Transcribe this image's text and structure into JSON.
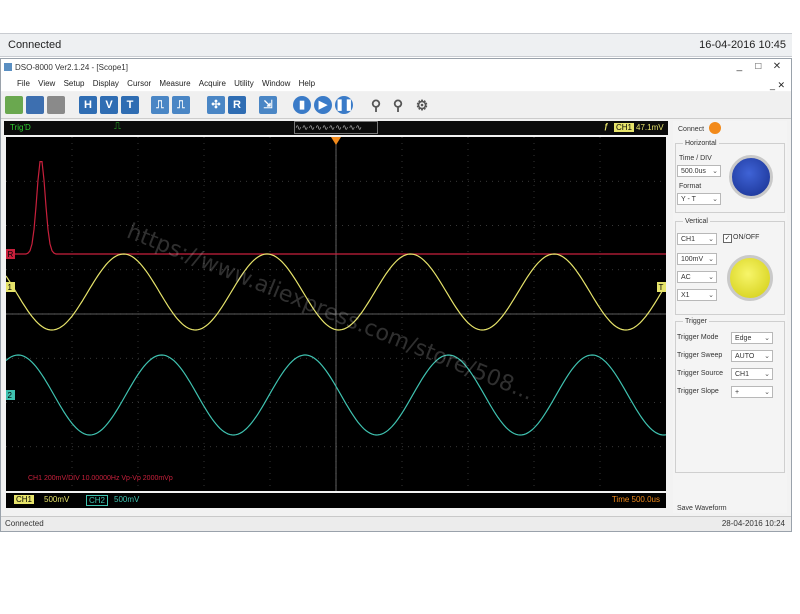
{
  "top_status": {
    "left": "Connected",
    "right": "16-04-2016  10:45"
  },
  "window": {
    "title": "DSO-8000 Ver2.1.24 - [Scope1]",
    "buttons": [
      "_",
      "□",
      "✕"
    ]
  },
  "menu": [
    "File",
    "View",
    "Setup",
    "Display",
    "Cursor",
    "Measure",
    "Acquire",
    "Utility",
    "Window",
    "Help"
  ],
  "menu_mdi_buttons": "_ ✕",
  "toolbar": {
    "letter_buttons": [
      "H",
      "V",
      "T",
      "R"
    ],
    "icons": [
      "open-folder-icon",
      "save-icon",
      "print-icon",
      "horizontal-icon",
      "vertical-icon",
      "trigger-icon",
      "pulse-icon",
      "pulse-icon",
      "measure-icon",
      "reference-icon",
      "export-icon",
      "single-icon",
      "run-icon",
      "stop-icon",
      "zoom-in-icon",
      "zoom-out-icon",
      "settings-icon"
    ]
  },
  "scope_bar": {
    "status": "Trig'D",
    "trigger_ch": "CH1",
    "trigger_level": "47.1mV"
  },
  "scope_info": {
    "line": "CH1  200mV/DIV   10.00000Hz   Vp-Vp  2000mVp"
  },
  "channel_markers": {
    "ref": "R",
    "ch1": "1",
    "ch2": "2",
    "trig": "T"
  },
  "bottom_bar": {
    "ch1_label": "CH1",
    "ch1_scale": "500mV",
    "ch2_label": "CH2",
    "ch2_scale": "500mV",
    "time": "Time  500.0us"
  },
  "app_status": {
    "left": "Connected",
    "right": "28-04-2016  10:24"
  },
  "panel": {
    "connect_label": "Connect",
    "horizontal": {
      "title": "Horizontal",
      "time_div_label": "Time / DIV",
      "time_div_value": "500.0us",
      "format_label": "Format",
      "format_value": "Y - T"
    },
    "vertical": {
      "title": "Vertical",
      "channel": "CH1",
      "onoff_label": "ON/OFF",
      "volts": "100mV",
      "coupling": "AC",
      "probe": "X1"
    },
    "trigger": {
      "title": "Trigger",
      "mode_label": "Trigger Mode",
      "mode_value": "Edge",
      "sweep_label": "Trigger Sweep",
      "sweep_value": "AUTO",
      "source_label": "Trigger Source",
      "source_value": "CH1",
      "slope_label": "Trigger Slope",
      "slope_value": "+"
    },
    "save_label": "Save Waveform"
  },
  "watermark": "https://www.aliexpress.com/store/508...",
  "colors": {
    "ch1": "#e6e36a",
    "ch2": "#3fc2b0",
    "ref": "#c8203c",
    "grid": "#4a4a4a",
    "accent": "#f28a1b"
  }
}
